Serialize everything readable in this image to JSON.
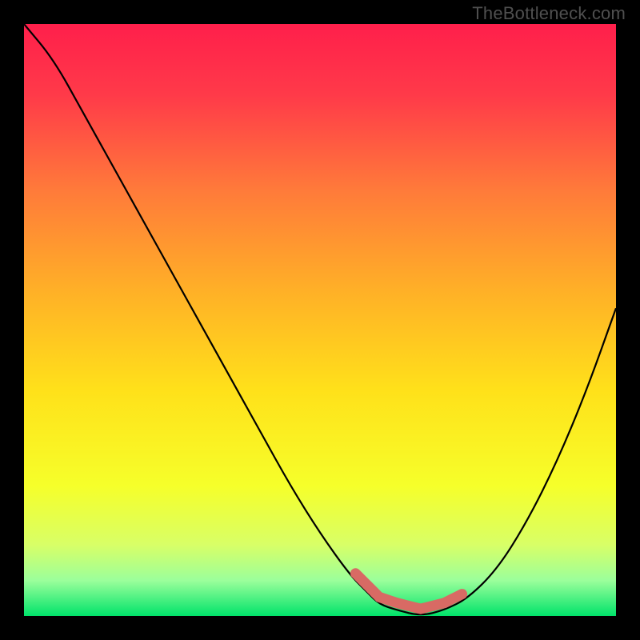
{
  "watermark": "TheBottleneck.com",
  "chart_data": {
    "type": "line",
    "title": "",
    "xlabel": "",
    "ylabel": "",
    "xlim": [
      0,
      100
    ],
    "ylim": [
      0,
      100
    ],
    "grid": false,
    "legend": false,
    "background_gradient": {
      "stops": [
        {
          "offset": 0.0,
          "color": "#ff1f4b"
        },
        {
          "offset": 0.12,
          "color": "#ff3a49"
        },
        {
          "offset": 0.28,
          "color": "#ff7a3a"
        },
        {
          "offset": 0.45,
          "color": "#ffb027"
        },
        {
          "offset": 0.62,
          "color": "#ffe11a"
        },
        {
          "offset": 0.78,
          "color": "#f6ff2a"
        },
        {
          "offset": 0.88,
          "color": "#d8ff67"
        },
        {
          "offset": 0.94,
          "color": "#9bff9b"
        },
        {
          "offset": 1.0,
          "color": "#00e36a"
        }
      ]
    },
    "series": [
      {
        "name": "bottleneck-curve",
        "color": "#000000",
        "x": [
          0,
          5,
          10,
          15,
          20,
          25,
          30,
          35,
          40,
          45,
          50,
          55,
          58,
          60,
          63,
          67,
          71,
          75,
          80,
          85,
          90,
          95,
          100
        ],
        "y": [
          100,
          94,
          85,
          76,
          67,
          58,
          49,
          40,
          31,
          22,
          14,
          7,
          4,
          2,
          1,
          0,
          1,
          3,
          8,
          16,
          26,
          38,
          52
        ]
      }
    ],
    "highlight": {
      "name": "optimal-range",
      "color": "#d86a64",
      "x_start": 56,
      "x_end": 74,
      "dot_x": 56,
      "dot_y": 6
    }
  }
}
